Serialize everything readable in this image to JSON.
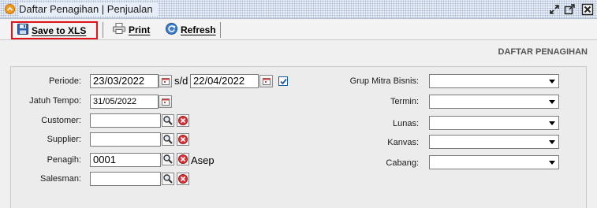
{
  "window": {
    "title": "Daftar Penagihan | Penjualan"
  },
  "toolbar": {
    "save_label": "Save to XLS",
    "print_label": "Print",
    "refresh_label": "Refresh"
  },
  "section_title": "DAFTAR PENAGIHAN",
  "filters": {
    "periode_label": "Periode:",
    "periode_from": "23/03/2022",
    "periode_sep": "s/d",
    "periode_to": "22/04/2022",
    "periode_checked": true,
    "jatuh_tempo_label": "Jatuh Tempo:",
    "jatuh_tempo_value": "31/05/2022",
    "customer_label": "Customer:",
    "customer_value": "",
    "supplier_label": "Supplier:",
    "supplier_value": "",
    "penagih_label": "Penagih:",
    "penagih_value": "0001",
    "penagih_name": "Asep",
    "salesman_label": "Salesman:",
    "salesman_value": "",
    "grup_label": "Grup Mitra Bisnis:",
    "grup_value": "",
    "termin_label": "Termin:",
    "termin_value": "",
    "lunas_label": "Lunas:",
    "lunas_value": "",
    "kanvas_label": "Kanvas:",
    "kanvas_value": "",
    "cabang_label": "Cabang:",
    "cabang_value": ""
  },
  "icons": {
    "app": "chevron-up-icon",
    "restore": "restore-icon",
    "maximize": "maximize-icon",
    "close": "close-icon",
    "save": "floppy-disk-icon",
    "print": "printer-icon",
    "refresh": "refresh-icon",
    "calendar": "calendar-icon",
    "lookup": "magnifier-icon",
    "clear": "clear-icon",
    "dropdown": "chevron-down-icon"
  },
  "colors": {
    "highlight": "#e0141c",
    "accent": "#1c5a9e"
  }
}
